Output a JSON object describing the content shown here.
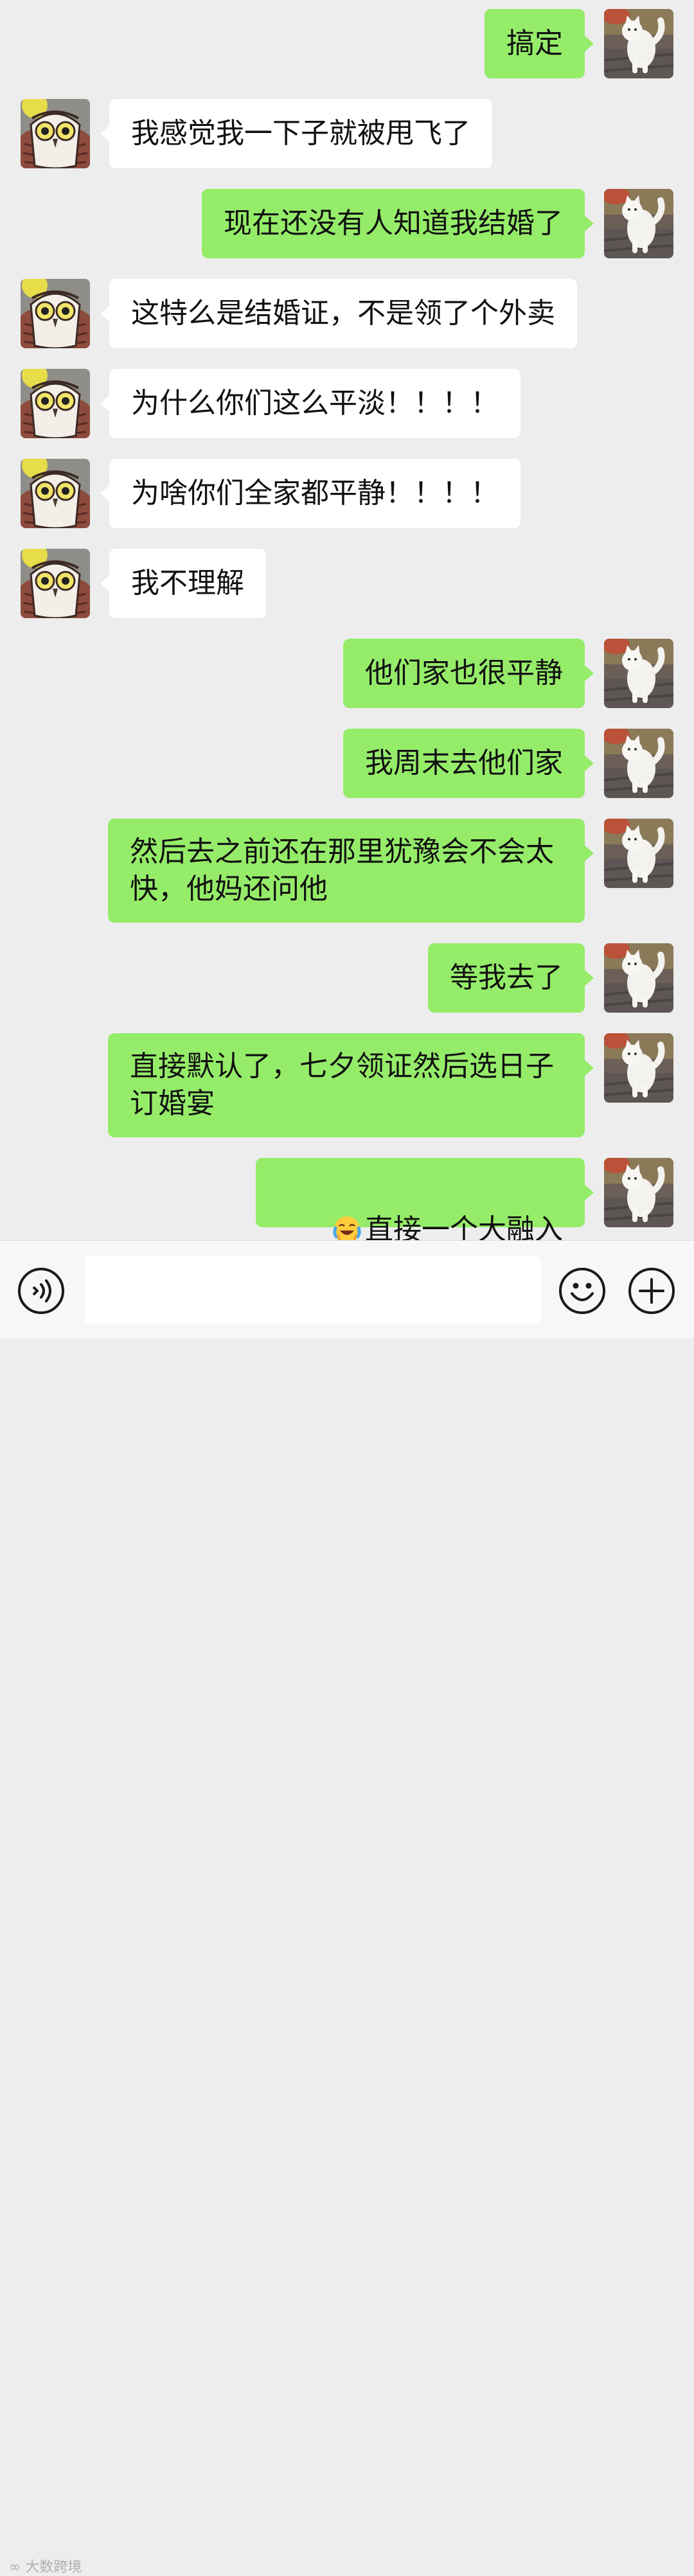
{
  "chat": {
    "messages": [
      {
        "sender": "me",
        "text": "搞定"
      },
      {
        "sender": "them",
        "text": "我感觉我一下子就被甩飞了"
      },
      {
        "sender": "me",
        "text": "现在还没有人知道我结婚了"
      },
      {
        "sender": "them",
        "text": "这特么是结婚证，不是领了个外卖"
      },
      {
        "sender": "them",
        "text": "为什么你们这么平淡！！！！"
      },
      {
        "sender": "them",
        "text": "为啥你们全家都平静！！！！"
      },
      {
        "sender": "them",
        "text": "我不理解"
      },
      {
        "sender": "me",
        "text": "他们家也很平静"
      },
      {
        "sender": "me",
        "text": "我周末去他们家"
      },
      {
        "sender": "me",
        "text": "然后去之前还在那里犹豫会不会太\n快，他妈还问他"
      },
      {
        "sender": "me",
        "text": "等我去了"
      },
      {
        "sender": "me",
        "text": "直接默认了，七夕领证然后选日子\n订婚宴"
      },
      {
        "sender": "me",
        "text": "直接一个大融入",
        "emoji": "laugh-cry-emoji"
      }
    ]
  },
  "colors": {
    "background": "#ededed",
    "my_bubble": "#95ec69",
    "their_bubble": "#ffffff",
    "input_bar": "#f7f7f7"
  },
  "input_bar": {
    "voice_icon": "voice-icon",
    "emoji_icon": "emoji-face-icon",
    "plus_icon": "plus-icon",
    "message_value": ""
  },
  "watermark": {
    "text": "大数跨境"
  }
}
